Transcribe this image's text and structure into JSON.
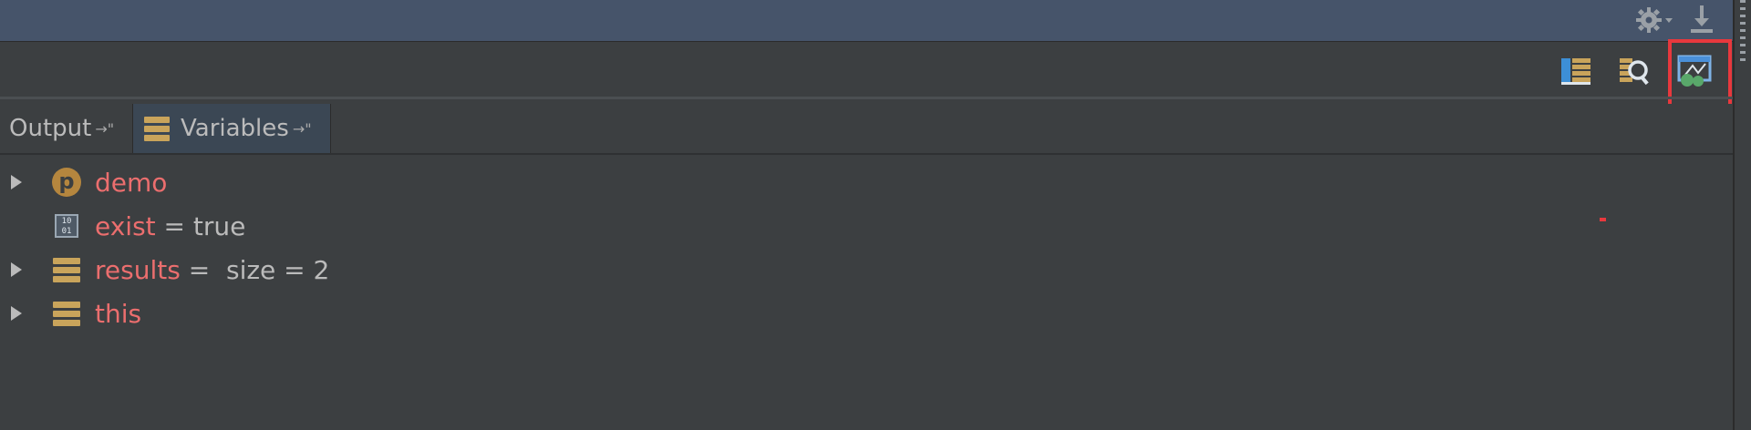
{
  "title_bar": {
    "icons": [
      "gear-icon",
      "download-icon"
    ]
  },
  "toolbar": {
    "icons": [
      "frames-icon",
      "evaluate-expression-icon",
      "restore-layout-icon"
    ],
    "highlighted": "restore-layout-icon",
    "highlight_color": "#e8383d"
  },
  "tabs": [
    {
      "label": "Output",
      "pin": "→\"",
      "active": false
    },
    {
      "label": "Variables",
      "pin": "→\"",
      "active": true
    }
  ],
  "variables": [
    {
      "name": "demo",
      "value": "",
      "expandable": true,
      "icon": "parameter-icon",
      "icon_text": "p"
    },
    {
      "name": "exist",
      "value": " = true",
      "expandable": false,
      "icon": "primitive-icon",
      "icon_text": "10\n01"
    },
    {
      "name": "results",
      "value": " =  size = 2",
      "expandable": true,
      "icon": "object-icon"
    },
    {
      "name": "this",
      "value": "",
      "expandable": true,
      "icon": "object-icon"
    }
  ],
  "colors": {
    "background": "#3c3f41",
    "title_bar": "#46546a",
    "variable_name": "#eb6e6e",
    "variable_value": "#bbbbbb"
  }
}
